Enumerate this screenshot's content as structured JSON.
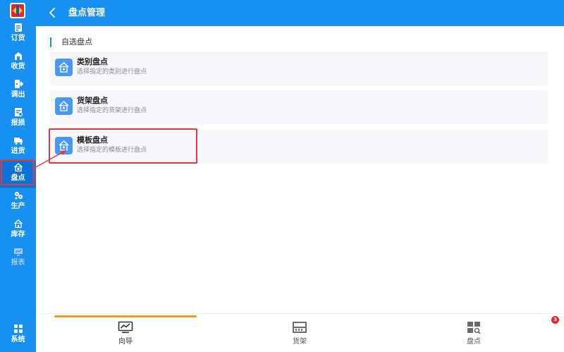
{
  "app": {
    "logo": "app-logo"
  },
  "sidebar": {
    "items": [
      {
        "label": "订货",
        "icon": "order-icon"
      },
      {
        "label": "收货",
        "icon": "receive-icon"
      },
      {
        "label": "调出",
        "icon": "transfer-out-icon"
      },
      {
        "label": "报损",
        "icon": "loss-report-icon"
      },
      {
        "label": "进货",
        "icon": "purchase-icon"
      },
      {
        "label": "盘点",
        "icon": "stocktake-icon",
        "active": true
      },
      {
        "label": "生产",
        "icon": "production-icon"
      },
      {
        "label": "库存",
        "icon": "inventory-icon"
      },
      {
        "label": "报表",
        "icon": "report-icon",
        "disabled": true
      }
    ],
    "system_label": "系统"
  },
  "header": {
    "title": "盘点管理"
  },
  "main": {
    "section_title": "自选盘点",
    "cards": [
      {
        "title": "类别盘点",
        "desc": "选择指定的类别进行盘点"
      },
      {
        "title": "货架盘点",
        "desc": "选择指定的货架进行盘点"
      },
      {
        "title": "模板盘点",
        "desc": "选择指定的模板进行盘点"
      }
    ]
  },
  "tabs": [
    {
      "label": "向导",
      "icon": "chart-monitor-icon",
      "active": true
    },
    {
      "label": "货架",
      "icon": "shelf-icon"
    },
    {
      "label": "盘点",
      "icon": "grid-search-icon"
    }
  ],
  "badge": {
    "count": "3"
  },
  "colors": {
    "primary": "#1890f0",
    "active_tab": "#f39a1e",
    "highlight": "#e8363a",
    "badge": "#e8262c"
  }
}
